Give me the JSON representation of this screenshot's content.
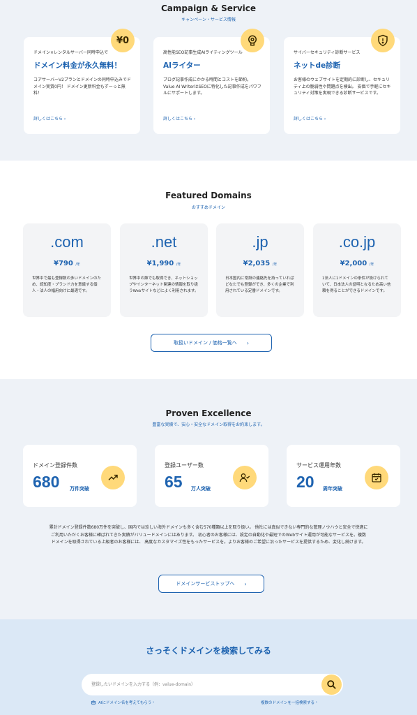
{
  "campaign": {
    "title": "Campaign & Service",
    "subtitle": "キャンペーン・サービス情報",
    "cards": [
      {
        "badge": "¥0",
        "eyebrow": "ドメイン×レンタルサーバー同時申込で",
        "heading": "ドメイン料金が永久無料！",
        "desc": "コアサーバーV2プランとドメインの同時申込みでドメイン実質0円！ ドメイン更新料金もずーっと無料！",
        "link": "詳しくはこちら"
      },
      {
        "badge_icon": "ai-brain-icon",
        "eyebrow": "高性能SEO記事生成AIライティングツール",
        "heading": "AIライター",
        "desc": "ブログ記事作成にかかる時間とコストを節約。 Value AI WriterはSEOに特化した記事作成をパワフルにサポートします。",
        "link": "詳しくはこちら"
      },
      {
        "badge_icon": "shield-alert-icon",
        "eyebrow": "サイバーセキュリティ診断サービス",
        "heading": "ネットde診断",
        "desc": "お客様のウェブサイトを定期的に診断し、セキュリティ上の脆弱性や問題点を検出。 安価で手軽にセキュリティ対策を実現できる診断サービスです。",
        "link": "詳しくはこちら"
      }
    ]
  },
  "domains": {
    "title": "Featured Domains",
    "subtitle": "おすすめドメイン",
    "cards": [
      {
        "name": ".com",
        "price": "¥790",
        "unit": "/年",
        "desc": "世界中で最も登録数の多いドメインのため、認知度・ブランド力を意識する個人・法人の幅用向けに最適です。"
      },
      {
        "name": ".net",
        "price": "¥1,990",
        "unit": "/年",
        "desc": "世界中の誰でも取得でき、ネットショップやインターネット関連の情報を取り扱うWebサイトなどによく利用されます。"
      },
      {
        "name": ".jp",
        "price": "¥2,035",
        "unit": "/年",
        "desc": "日本国内に常設の連絡先を持っていればどなたでも登録ができ、多くの企業で利用されている定番ドメインです。"
      },
      {
        "name": ".co.jp",
        "price": "¥2,000",
        "unit": "/年",
        "desc": "1法人に1ドメインの条件が設けられていて、日本法人の証明となるため高い信頼を得ることができるドメインです。"
      }
    ],
    "button": "取扱いドメイン / 価格一覧へ"
  },
  "proven": {
    "title": "Proven Excellence",
    "subtitle": "豊富な実績で、安心・安全なドメイン取得をお約束します。",
    "stats": [
      {
        "label": "ドメイン登録件数",
        "num": "680",
        "unit": "万件突破",
        "icon": "trending-up-icon"
      },
      {
        "label": "登録ユーザー数",
        "num": "65",
        "unit": "万人突破",
        "icon": "user-check-icon"
      },
      {
        "label": "サービス運用年数",
        "num": "20",
        "unit": "周年突破",
        "icon": "calendar-check-icon"
      }
    ],
    "text": "累計ドメイン登録件数680万件を突破し、国内では珍しい海外ドメインも多く含む570種類以上を取り扱い。 他社には真似できない専門的な管理ノウハウと安全で快適にご利用いただくお客様に確ばれてきた実績がバリュードメインにはあります。 初心者のお客様には、設定の自動化や最短でのWebサイト運用が可能なサービスを。複数ドメインを取得されている上級者のお客様には、 高度なカスタマイズ性をもったサービスを。よりお客様のご希望に沿ったサービスを提供するため、変化し続けます。",
    "button": "ドメインサービストップへ"
  },
  "search": {
    "title": "さっそくドメインを検索してみる",
    "placeholder": "登録したいドメインを入力する（例：value-domain）",
    "link_ai": "AIにドメイン名を考えてもらう",
    "link_bulk": "複数のドメインを一括検索する"
  },
  "colors": {
    "brand": "#1e63b0",
    "accent": "#ffd97a"
  }
}
